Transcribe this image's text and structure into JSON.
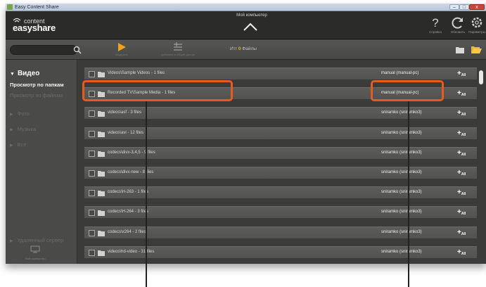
{
  "window": {
    "title": "Easy Content Share",
    "min_glyph": "–",
    "max_glyph": "□",
    "close_glyph": "x"
  },
  "header": {
    "logo_top": "content",
    "logo_bottom": "easyshare",
    "computer_title": "Мой компьютер",
    "help_label": "Справка",
    "refresh_label": "Обновить",
    "settings_label": "Параметры"
  },
  "toolbar": {
    "search_placeholder": "",
    "download_label": "Загрузить",
    "add_label": "Добавить в общий доступ",
    "files_prefix": "Итг",
    "files_count": "0",
    "files_label": "Файлы"
  },
  "sidebar": {
    "video": "Видео",
    "by_folders": "Просмотр по папкам",
    "by_files": "Просмотр по файлам",
    "photo": "Фото",
    "music": "Музыка",
    "all": "Все",
    "remote": "Удаленный сервер",
    "computer": "Мой компьютер"
  },
  "rows": [
    {
      "name": "Videos\\Sample Videos - 1 files",
      "owner": "manual (manual-pc)"
    },
    {
      "name": "Recorded TV\\Sample Media - 1 files",
      "owner": "manual (manual-pc)"
    },
    {
      "name": "videos\\asf - 3 files",
      "owner": "sniramko (sniramko3)"
    },
    {
      "name": "videos\\avi - 12 files",
      "owner": "sniramko (sniramko3)"
    },
    {
      "name": "codecs\\divx-3,4,5 - 9 files",
      "owner": "sniramko (sniramko3)"
    },
    {
      "name": "codecs\\divx-new - 8 files",
      "owner": "sniramko (sniramko3)"
    },
    {
      "name": "codecs\\H-263 - 1 files",
      "owner": "sniramko (sniramko3)"
    },
    {
      "name": "codecs\\H-264 - 3 files",
      "owner": "sniramko (sniramko3)"
    },
    {
      "name": "codecs\\x264 - 2 files",
      "owner": "sniramko (sniramko3)"
    },
    {
      "name": "videos\\hd-video - 31 files",
      "owner": "sniramko (sniramko3)"
    }
  ],
  "add_all": {
    "plus": "+",
    "label": "All"
  },
  "colors": {
    "accent": "#e45d1e",
    "count": "#f0b500"
  }
}
